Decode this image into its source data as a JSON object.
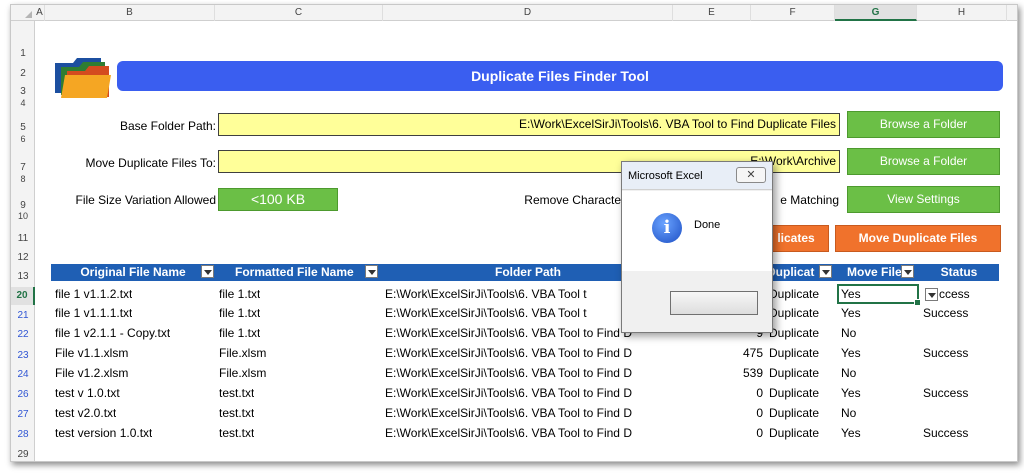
{
  "columns": [
    "A",
    "B",
    "C",
    "D",
    "E",
    "F",
    "G",
    "H"
  ],
  "rows": [
    "1",
    "2",
    "3",
    "4",
    "5",
    "6",
    "7",
    "8",
    "9",
    "10",
    "11",
    "12",
    "13",
    "20",
    "21",
    "22",
    "23",
    "24",
    "26",
    "27",
    "28",
    "29"
  ],
  "title": "Duplicate Files Finder Tool",
  "form": {
    "base_label": "Base Folder Path:",
    "base_value": "E:\\Work\\ExcelSirJi\\Tools\\6. VBA Tool to Find Duplicate Files",
    "move_label": "Move Duplicate Files To:",
    "move_value": "E:\\Work\\Archive",
    "size_label": "File Size Variation Allowed",
    "size_value": "<100 KB",
    "remove_label": "Remove Characte",
    "matching_label": "e Matching"
  },
  "buttons": {
    "browse1": "Browse a Folder",
    "browse2": "Browse a Folder",
    "view_settings": "View Settings",
    "find_duplicates": "licates",
    "move_duplicates": "Move Duplicate Files"
  },
  "table": {
    "headers": {
      "original": "Original File Name",
      "formatted": "Formatted File Name",
      "folder": "Folder Path",
      "dup": "Duplicat",
      "move": "Move File",
      "status": "Status"
    },
    "rows": [
      {
        "row": "20",
        "original": "file 1 v1.1.2.txt",
        "formatted": "file 1.txt",
        "folder": "E:\\Work\\ExcelSirJi\\Tools\\6. VBA Tool t",
        "size": "",
        "dup": "Duplicate",
        "move": "Yes",
        "status": "ccess"
      },
      {
        "row": "21",
        "original": "file 1 v1.1.1.txt",
        "formatted": "file 1.txt",
        "folder": "E:\\Work\\ExcelSirJi\\Tools\\6. VBA Tool t",
        "size": "",
        "dup": "Duplicate",
        "move": "Yes",
        "status": "Success"
      },
      {
        "row": "22",
        "original": "file 1 v2.1.1 - Copy.txt",
        "formatted": "file 1.txt",
        "folder": "E:\\Work\\ExcelSirJi\\Tools\\6. VBA Tool to Find D",
        "size": "9",
        "dup": "Duplicate",
        "move": "No",
        "status": ""
      },
      {
        "row": "23",
        "original": "File v1.1.xlsm",
        "formatted": "File.xlsm",
        "folder": "E:\\Work\\ExcelSirJi\\Tools\\6. VBA Tool to Find D",
        "size": "475",
        "dup": "Duplicate",
        "move": "Yes",
        "status": "Success"
      },
      {
        "row": "24",
        "original": "File v1.2.xlsm",
        "formatted": "File.xlsm",
        "folder": "E:\\Work\\ExcelSirJi\\Tools\\6. VBA Tool to Find D",
        "size": "539",
        "dup": "Duplicate",
        "move": "No",
        "status": ""
      },
      {
        "row": "26",
        "original": "test v 1.0.txt",
        "formatted": "test.txt",
        "folder": "E:\\Work\\ExcelSirJi\\Tools\\6. VBA Tool to Find D",
        "size": "0",
        "dup": "Duplicate",
        "move": "Yes",
        "status": "Success"
      },
      {
        "row": "27",
        "original": "test v2.0.txt",
        "formatted": "test.txt",
        "folder": "E:\\Work\\ExcelSirJi\\Tools\\6. VBA Tool to Find D",
        "size": "0",
        "dup": "Duplicate",
        "move": "No",
        "status": ""
      },
      {
        "row": "28",
        "original": "test version 1.0.txt",
        "formatted": "test.txt",
        "folder": "E:\\Work\\ExcelSirJi\\Tools\\6. VBA Tool to Find D",
        "size": "0",
        "dup": "Duplicate",
        "move": "Yes",
        "status": "Success"
      }
    ]
  },
  "dialog": {
    "title": "Microsoft Excel",
    "close": "✕",
    "message": "Done",
    "ok": ""
  },
  "colors": {
    "title_bar": "#3a5ef0",
    "header_blue": "#1f5fb4",
    "input_yellow": "#ffff99",
    "button_green": "#6bbf46",
    "button_orange": "#f0722c"
  }
}
